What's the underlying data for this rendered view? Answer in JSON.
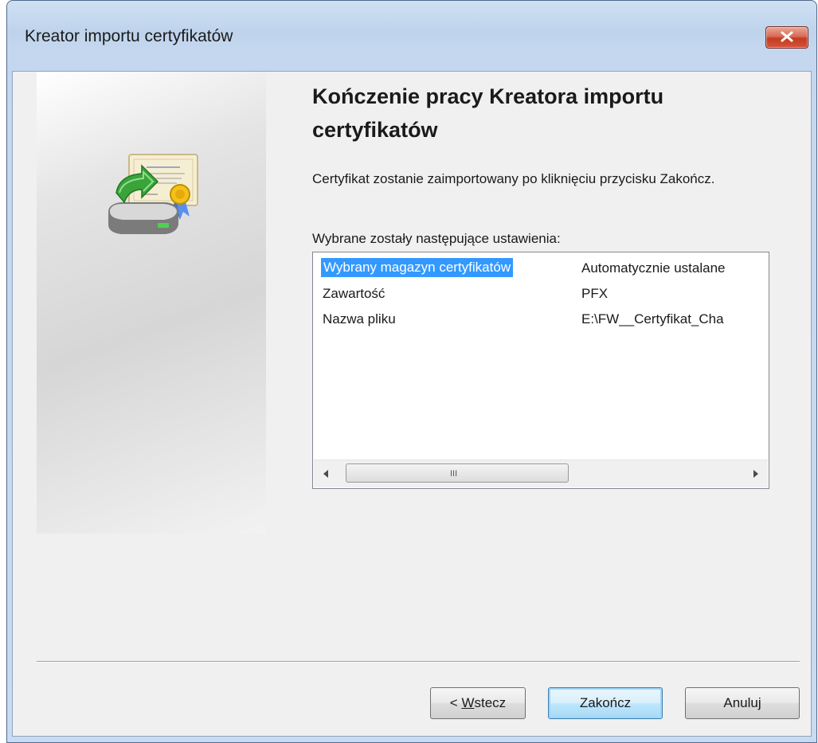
{
  "window": {
    "title": "Kreator importu certyfikatów",
    "close_icon": "close-x-icon"
  },
  "side_panel": {
    "icon": "certificate-import-icon"
  },
  "content": {
    "heading": "Kończenie pracy Kreatora importu certyfikatów",
    "description": "Certyfikat zostanie zaimportowany po kliknięciu przycisku Zakończ.",
    "settings_label": "Wybrane zostały następujące ustawienia:"
  },
  "settings_list": {
    "rows": [
      {
        "name": "Wybrany magazyn certyfikatów",
        "value": "Automatycznie ustalane",
        "selected": true
      },
      {
        "name": "Zawartość",
        "value": "PFX",
        "selected": false
      },
      {
        "name": "Nazwa pliku",
        "value": "E:\\FW__Certyfikat_Cha",
        "selected": false
      }
    ],
    "scrollbar_grip": "III"
  },
  "buttons": {
    "back_prefix": "< ",
    "back_accel": "W",
    "back_rest": "stecz",
    "finish": "Zakończ",
    "cancel": "Anuluj"
  },
  "colors": {
    "selection": "#3399ff",
    "default_button_border": "#3c7fb1"
  }
}
